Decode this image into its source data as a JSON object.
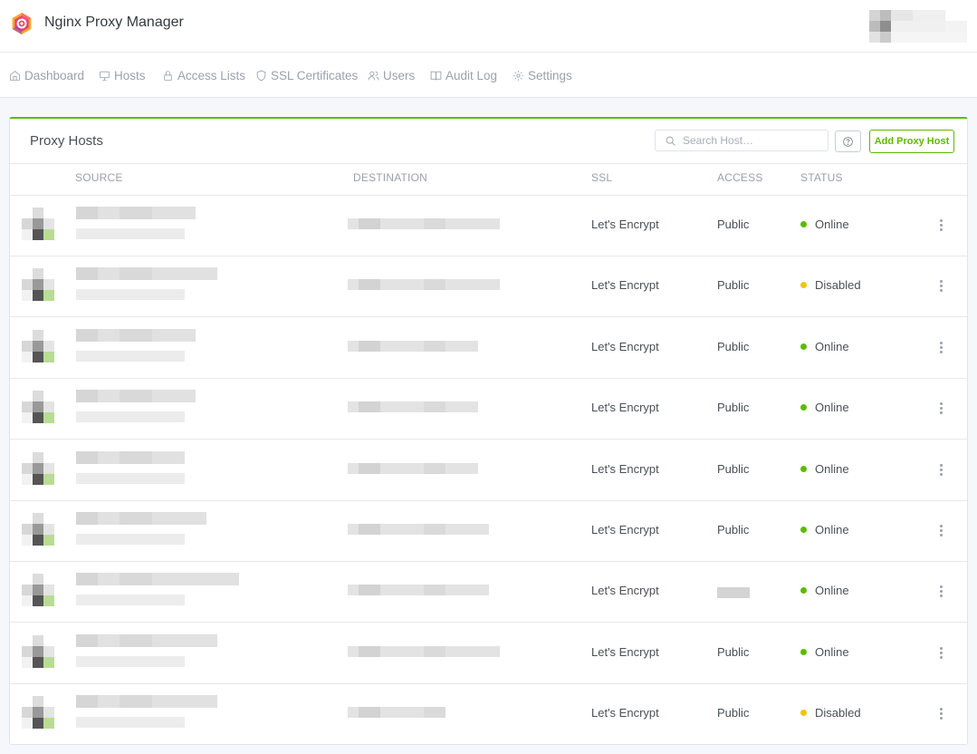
{
  "app": {
    "title": "Nginx Proxy Manager"
  },
  "nav": {
    "items": [
      {
        "label": "Dashboard",
        "icon": "home-icon"
      },
      {
        "label": "Hosts",
        "icon": "monitor-icon"
      },
      {
        "label": "Access Lists",
        "icon": "lock-icon"
      },
      {
        "label": "SSL Certificates",
        "icon": "shield-icon"
      },
      {
        "label": "Users",
        "icon": "users-icon"
      },
      {
        "label": "Audit Log",
        "icon": "book-icon"
      },
      {
        "label": "Settings",
        "icon": "gear-icon"
      }
    ]
  },
  "card": {
    "title": "Proxy Hosts",
    "search_placeholder": "Search Host…",
    "add_label": "Add Proxy Host"
  },
  "table": {
    "columns": {
      "source": "SOURCE",
      "destination": "DESTINATION",
      "ssl": "SSL",
      "access": "ACCESS",
      "status": "STATUS"
    },
    "rows": [
      {
        "ssl": "Let's Encrypt",
        "access": "Public",
        "status": "Online"
      },
      {
        "ssl": "Let's Encrypt",
        "access": "Public",
        "status": "Disabled"
      },
      {
        "ssl": "Let's Encrypt",
        "access": "Public",
        "status": "Online"
      },
      {
        "ssl": "Let's Encrypt",
        "access": "Public",
        "status": "Online"
      },
      {
        "ssl": "Let's Encrypt",
        "access": "Public",
        "status": "Online"
      },
      {
        "ssl": "Let's Encrypt",
        "access": "Public",
        "status": "Online"
      },
      {
        "ssl": "Let's Encrypt",
        "access": "",
        "status": "Online"
      },
      {
        "ssl": "Let's Encrypt",
        "access": "Public",
        "status": "Online"
      },
      {
        "ssl": "Let's Encrypt",
        "access": "Public",
        "status": "Disabled"
      }
    ]
  },
  "colors": {
    "accent": "#5eba00",
    "online": "#5eba00",
    "disabled": "#f1c40f",
    "muted": "#9aa0ac"
  }
}
